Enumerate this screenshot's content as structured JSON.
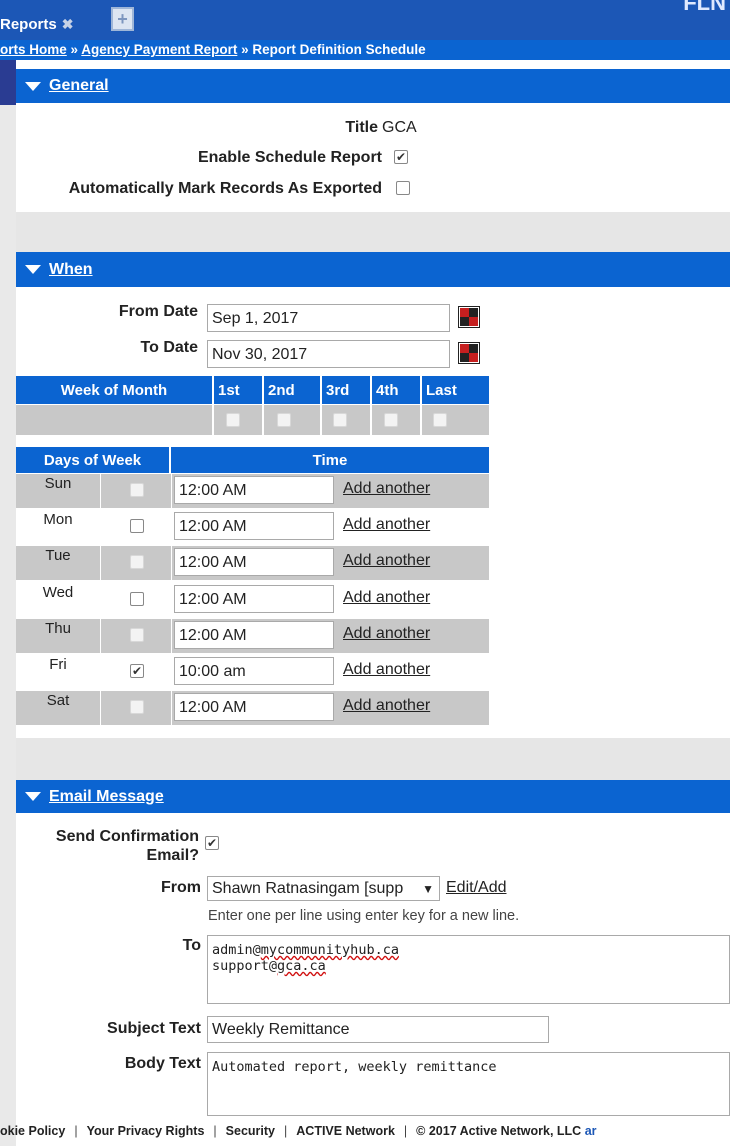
{
  "header": {
    "top_right_text": "FLN",
    "tab_label": "Reports",
    "tab_close": "✖",
    "tab_add": "+"
  },
  "breadcrumb": {
    "items": [
      "orts Home",
      "Agency Payment Report",
      "Report Definition Schedule"
    ],
    "separator": " » "
  },
  "general": {
    "section_title": "General",
    "title_label": "Title",
    "title_value": "GCA",
    "enable_schedule_label": "Enable Schedule Report",
    "enable_schedule_checked": true,
    "auto_mark_label": "Automatically Mark Records As Exported",
    "auto_mark_checked": false
  },
  "when": {
    "section_title": "When",
    "from_date_label": "From Date",
    "from_date_value": "Sep 1, 2017",
    "to_date_label": "To Date",
    "to_date_value": "Nov 30, 2017",
    "week_of_month_header": "Week of Month",
    "weeks": [
      "1st",
      "2nd",
      "3rd",
      "4th",
      "Last"
    ],
    "days_of_week_header": "Days of Week",
    "time_header": "Time",
    "add_link_label": "Add another",
    "days": [
      {
        "name": "Sun",
        "checked": false,
        "time": "12:00 AM",
        "grey": true
      },
      {
        "name": "Mon",
        "checked": false,
        "time": "12:00 AM",
        "grey": false
      },
      {
        "name": "Tue",
        "checked": false,
        "time": "12:00 AM",
        "grey": true
      },
      {
        "name": "Wed",
        "checked": false,
        "time": "12:00 AM",
        "grey": false
      },
      {
        "name": "Thu",
        "checked": false,
        "time": "12:00 AM",
        "grey": true
      },
      {
        "name": "Fri",
        "checked": true,
        "time": "10:00 am",
        "grey": false
      },
      {
        "name": "Sat",
        "checked": false,
        "time": "12:00 AM",
        "grey": true
      }
    ]
  },
  "email": {
    "section_title": "Email Message",
    "send_confirmation_label_line1": "Send Confirmation",
    "send_confirmation_label_line2": "Email?",
    "send_confirmation_checked": true,
    "from_label": "From",
    "from_value": "Shawn Ratnasingam [supp",
    "from_arrow": "▼",
    "edit_add_label": "Edit/Add",
    "to_hint": "Enter one per line using enter key for a new line.",
    "to_label": "To",
    "to_line1_prefix": "admin@",
    "to_line1_wavy": "mycommunityhub.ca",
    "to_line2_prefix": "support@",
    "to_line2_wavy": "gca.ca",
    "subject_label": "Subject Text",
    "subject_value": "Weekly Remittance",
    "body_label": "Body Text",
    "body_value": "Automated report, weekly remittance"
  },
  "footer": {
    "items": [
      "okie Policy",
      "Your Privacy Rights",
      "Security",
      "ACTIVE Network",
      "© 2017 Active Network, LLC"
    ],
    "tail": "ar",
    "separator": "|"
  },
  "colors": {
    "primary_blue": "#0b64d1",
    "top_blue": "#1c57b6",
    "grey_row": "#c8c8c8",
    "gap_grey": "#e6e6e6"
  }
}
